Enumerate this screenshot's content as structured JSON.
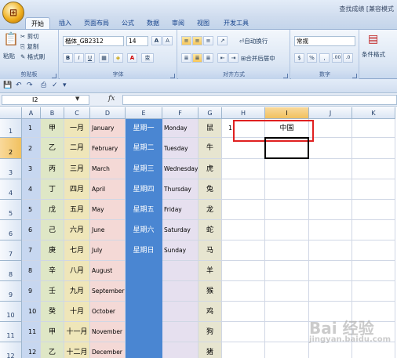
{
  "window": {
    "title": "查找成绩 [兼容模式"
  },
  "tabs": [
    "开始",
    "插入",
    "页面布局",
    "公式",
    "数据",
    "审阅",
    "视图",
    "开发工具"
  ],
  "ribbon": {
    "clipboard": {
      "label": "剪贴板",
      "paste": "粘贴",
      "cut": "剪切",
      "copy": "复制",
      "format_painter": "格式刷"
    },
    "font": {
      "label": "字体",
      "font_name": "楷体_GB2312",
      "font_size": "14",
      "grow": "A",
      "shrink": "A",
      "bold": "B",
      "italic": "I",
      "underline": "U",
      "font_color": "A",
      "phonetic": "变"
    },
    "alignment": {
      "label": "对齐方式",
      "wrap": "自动换行",
      "merge": "合并后居中"
    },
    "number": {
      "label": "数字",
      "format": "常规",
      "percent": "%",
      "comma": ",",
      "inc": ".00",
      "dec": ".0"
    },
    "styles": {
      "conditional": "条件格式"
    }
  },
  "formula_bar": {
    "name_box": "I2",
    "fx": "fx"
  },
  "columns": [
    "A",
    "B",
    "C",
    "D",
    "E",
    "F",
    "G",
    "H",
    "I",
    "J",
    "K"
  ],
  "selected_column": "I",
  "selected_row": "2",
  "rows": [
    {
      "num": "1",
      "a": "1",
      "b": "甲",
      "c": "一月",
      "d": "January",
      "e": "星期一",
      "f": "Monday",
      "g": "鼠",
      "h": "1",
      "i": "中国"
    },
    {
      "num": "2",
      "a": "2",
      "b": "乙",
      "c": "二月",
      "d": "February",
      "e": "星期二",
      "f": "Tuesday",
      "g": "牛",
      "h": "",
      "i": ""
    },
    {
      "num": "3",
      "a": "3",
      "b": "丙",
      "c": "三月",
      "d": "March",
      "e": "星期三",
      "f": "Wednesday",
      "g": "虎",
      "h": "",
      "i": ""
    },
    {
      "num": "4",
      "a": "4",
      "b": "丁",
      "c": "四月",
      "d": "April",
      "e": "星期四",
      "f": "Thursday",
      "g": "兔",
      "h": "",
      "i": ""
    },
    {
      "num": "5",
      "a": "5",
      "b": "戊",
      "c": "五月",
      "d": "May",
      "e": "星期五",
      "f": "Friday",
      "g": "龙",
      "h": "",
      "i": ""
    },
    {
      "num": "6",
      "a": "6",
      "b": "己",
      "c": "六月",
      "d": "June",
      "e": "星期六",
      "f": "Saturday",
      "g": "蛇",
      "h": "",
      "i": ""
    },
    {
      "num": "7",
      "a": "7",
      "b": "庚",
      "c": "七月",
      "d": "July",
      "e": "星期日",
      "f": "Sunday",
      "g": "马",
      "h": "",
      "i": ""
    },
    {
      "num": "8",
      "a": "8",
      "b": "辛",
      "c": "八月",
      "d": "August",
      "e": "",
      "f": "",
      "g": "羊",
      "h": "",
      "i": ""
    },
    {
      "num": "9",
      "a": "9",
      "b": "壬",
      "c": "九月",
      "d": "September",
      "e": "",
      "f": "",
      "g": "猴",
      "h": "",
      "i": ""
    },
    {
      "num": "10",
      "a": "10",
      "b": "癸",
      "c": "十月",
      "d": "October",
      "e": "",
      "f": "",
      "g": "鸡",
      "h": "",
      "i": ""
    },
    {
      "num": "11",
      "a": "11",
      "b": "甲",
      "c": "十一月",
      "d": "November",
      "e": "",
      "f": "",
      "g": "狗",
      "h": "",
      "i": ""
    },
    {
      "num": "12",
      "a": "12",
      "b": "乙",
      "c": "十二月",
      "d": "December",
      "e": "",
      "f": "",
      "g": "猪",
      "h": "",
      "i": ""
    }
  ],
  "column_fills": {
    "A": "#c7d7f0",
    "B": "#dfe7c6",
    "C": "#efe6b9",
    "D": "#f4d9d6",
    "E": "#4a86d2",
    "F": "#e6e0ef",
    "G": "#e7e5d0"
  },
  "watermark": {
    "text": "Bai 经验",
    "sub": "jingyan.baidu.com"
  }
}
